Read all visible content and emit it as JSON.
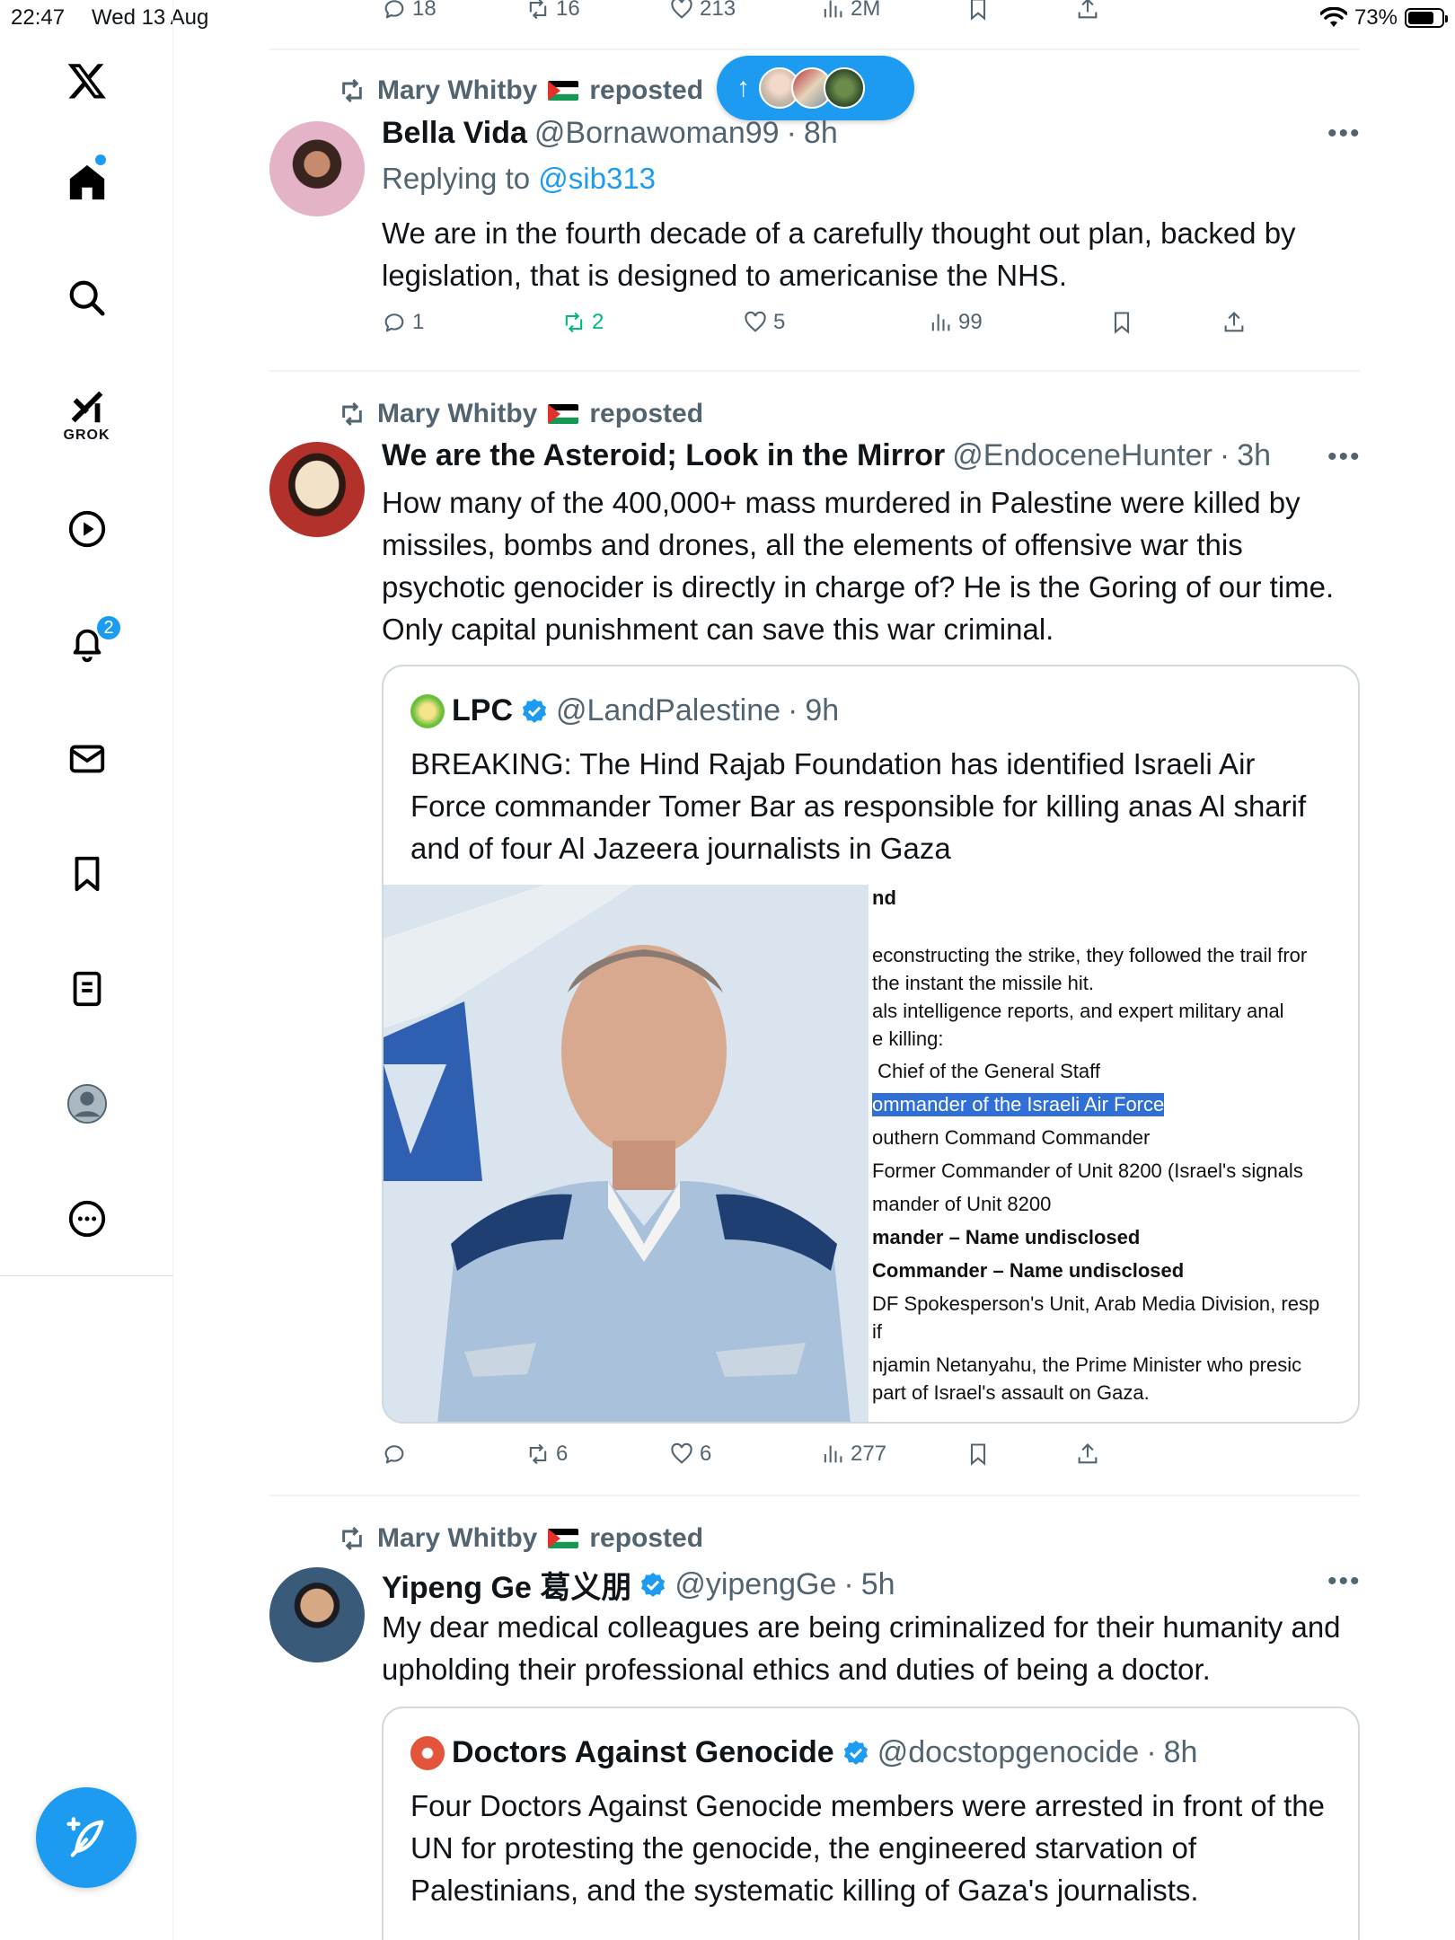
{
  "status_bar": {
    "time": "22:47",
    "date": "Wed 13 Aug",
    "battery": "73%"
  },
  "sidebar": {
    "grok_label": "GROK",
    "notifications_badge": "2",
    "items": [
      "x-logo",
      "home",
      "search",
      "grok",
      "video",
      "notifications",
      "messages",
      "bookmarks",
      "lists",
      "profile",
      "more"
    ]
  },
  "top_actions": {
    "replies": "18",
    "reposts": "16",
    "likes": "213",
    "views": "2M"
  },
  "new_posts_pill": {
    "arrow": "↑"
  },
  "posts": [
    {
      "reposted_by": "Mary Whitby",
      "reposted_label": "reposted",
      "name": "Bella Vida",
      "handle": "@Bornawoman99",
      "time": "8h",
      "replying_prefix": "Replying to",
      "replying_to": "@sib313",
      "text": "We are in the fourth decade of a carefully thought out plan, backed by legislation, that is designed to americanise the NHS.",
      "replies": "1",
      "reposts": "2",
      "likes": "5",
      "views": "99"
    },
    {
      "reposted_by": "Mary Whitby",
      "reposted_label": "reposted",
      "name": "We are the Asteroid; Look in the Mirror",
      "handle": "@EndoceneHunter",
      "time": "3h",
      "text": "How many of the 400,000+ mass murdered in Palestine were killed by missiles, bombs and drones, all the elements of offensive war  this psychotic genocider is directly in charge of? He is the Goring of our time. Only capital punishment can save this war criminal.",
      "quote": {
        "name": "LPC",
        "handle": "@LandPalestine",
        "time": "9h",
        "text": "BREAKING: The Hind Rajab Foundation has identified Israeli Air Force commander Tomer Bar as responsible for killing anas Al sharif and of four Al Jazeera journalists in Gaza",
        "doc_lines": [
          "nd",
          "econstructing the strike, they followed the trail fror",
          " the instant the missile hit.",
          "als  intelligence  reports,  and  expert  military  anal",
          "e killing:",
          " Chief of the General Staff",
          "ommander of the Israeli Air Force",
          "outhern Command Commander",
          " Former Commander of Unit 8200 (Israel's signals",
          "mander of Unit 8200",
          "mander – Name undisclosed",
          " Commander – Name undisclosed",
          "DF  Spokesperson's Unit, Arab Media Division, resp",
          "if",
          "njamin Netanyahu, the Prime Minister who presic",
          " part of Israel's assault on Gaza."
        ]
      },
      "replies": "",
      "reposts": "6",
      "likes": "6",
      "views": "277"
    },
    {
      "reposted_by": "Mary Whitby",
      "reposted_label": "reposted",
      "name": "Yipeng Ge 葛义朋",
      "handle": "@yipengGe",
      "time": "5h",
      "text": "My dear medical colleagues are being criminalized for their humanity and upholding their professional ethics and duties of being a doctor.",
      "quote": {
        "name": "Doctors Against Genocide",
        "handle": "@docstopgenocide",
        "time": "8h",
        "text": "Four Doctors Against Genocide members were arrested in front of the UN for protesting the genocide, the engineered starvation of Palestinians, and the systematic killing of Gaza's journalists."
      }
    }
  ],
  "colors": {
    "accent": "#1d9bf0",
    "repost_green": "#00ba7c",
    "muted": "#536471"
  }
}
